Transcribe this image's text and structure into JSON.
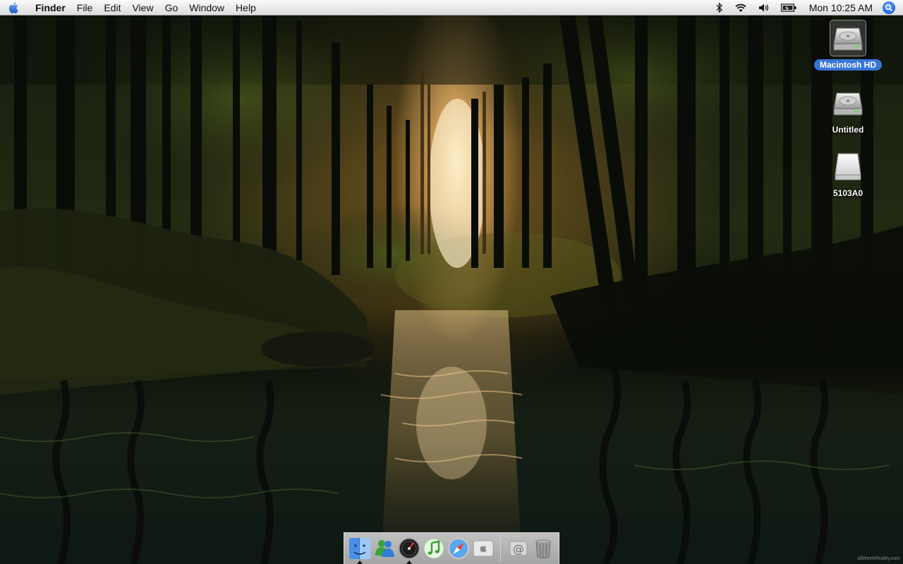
{
  "menubar": {
    "apple_icon": "apple-logo-icon",
    "app_name": "Finder",
    "menus": [
      "File",
      "Edit",
      "View",
      "Go",
      "Window",
      "Help"
    ],
    "status_icons": [
      "bluetooth-icon",
      "wifi-icon",
      "volume-icon",
      "battery-icon"
    ],
    "clock": "Mon 10:25 AM",
    "spotlight_icon": "spotlight-icon"
  },
  "desktop": {
    "icons": [
      {
        "label": "Macintosh HD",
        "icon": "hard-drive-icon",
        "selected": true
      },
      {
        "label": "Untitled",
        "icon": "hard-drive-icon",
        "selected": false
      },
      {
        "label": "5103A0",
        "icon": "removable-drive-icon",
        "selected": false
      }
    ]
  },
  "dock": {
    "items": [
      {
        "name": "Finder",
        "icon": "finder-icon",
        "running": true
      },
      {
        "name": "MSN Messenger",
        "icon": "messenger-icon",
        "running": false
      },
      {
        "name": "Dashboard",
        "icon": "dashboard-icon",
        "running": true
      },
      {
        "name": "iTunes",
        "icon": "itunes-icon",
        "running": false
      },
      {
        "name": "Safari",
        "icon": "safari-icon",
        "running": false
      },
      {
        "name": "System Preferences",
        "icon": "apple-prefs-icon",
        "running": false
      },
      {
        "name": "Mail",
        "icon": "mail-icon",
        "running": false
      },
      {
        "name": "Trash",
        "icon": "trash-icon",
        "running": false
      }
    ]
  },
  "watermark": "allWeekReality.com",
  "colors": {
    "selection": "#3875d7",
    "menubar_top": "#fafafa",
    "menubar_bottom": "#dcdcdc"
  }
}
